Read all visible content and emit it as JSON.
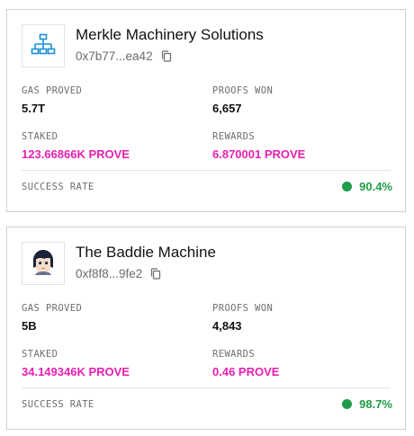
{
  "colors": {
    "accent_pink": "#e81fb3",
    "success_green": "#1f9d48",
    "logo_blue": "#1a8fd8"
  },
  "provers": [
    {
      "name": "Merkle Machinery Solutions",
      "address": "0x7b77...ea42",
      "logo_icon": "network-hierarchy-icon",
      "gas_proved_label": "GAS PROVED",
      "gas_proved": "5.7T",
      "proofs_won_label": "PROOFS WON",
      "proofs_won": "6,657",
      "staked_label": "STAKED",
      "staked": "123.66866K PROVE",
      "rewards_label": "REWARDS",
      "rewards": "6.870001 PROVE",
      "success_rate_label": "SUCCESS RATE",
      "success_rate": "90.4%"
    },
    {
      "name": "The Baddie Machine",
      "address": "0xf8f8...9fe2",
      "logo_icon": "pixel-avatar-icon",
      "gas_proved_label": "GAS PROVED",
      "gas_proved": "5B",
      "proofs_won_label": "PROOFS WON",
      "proofs_won": "4,843",
      "staked_label": "STAKED",
      "staked": "34.149346K PROVE",
      "rewards_label": "REWARDS",
      "rewards": "0.46 PROVE",
      "success_rate_label": "SUCCESS RATE",
      "success_rate": "98.7%"
    }
  ]
}
